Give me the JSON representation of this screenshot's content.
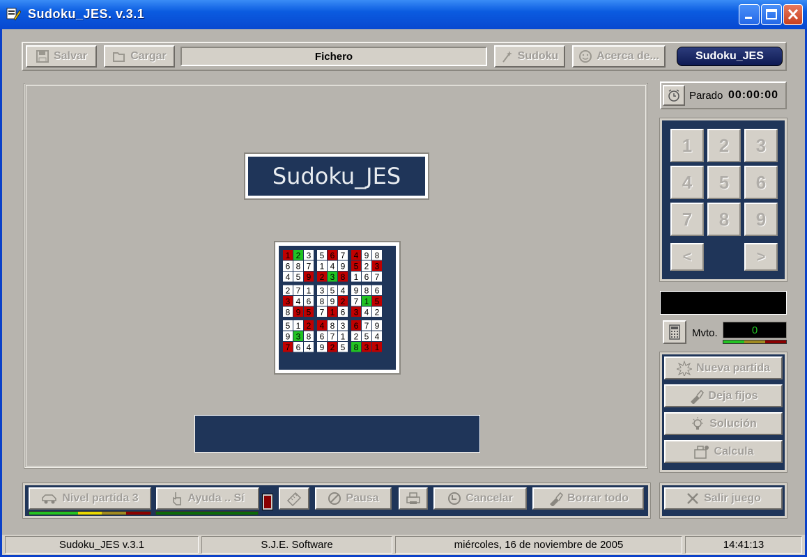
{
  "window": {
    "title": "Sudoku_JES. v.3.1"
  },
  "toolbar": {
    "salvar": "Salvar",
    "cargar": "Cargar",
    "fichero": "Fichero",
    "sudoku": "Sudoku",
    "acerca": "Acerca de...",
    "brand": "Sudoku_JES"
  },
  "main": {
    "logo_text": "Sudoku_JES",
    "thumbnail_grid": [
      [
        1,
        2,
        3,
        5,
        6,
        7,
        4,
        9,
        8
      ],
      [
        6,
        8,
        7,
        1,
        4,
        9,
        5,
        2,
        3
      ],
      [
        4,
        5,
        9,
        2,
        3,
        8,
        1,
        6,
        7
      ],
      [
        2,
        7,
        1,
        3,
        5,
        4,
        9,
        8,
        6
      ],
      [
        3,
        4,
        6,
        8,
        9,
        2,
        7,
        1,
        5
      ],
      [
        8,
        9,
        5,
        7,
        1,
        6,
        3,
        4,
        2
      ],
      [
        5,
        1,
        2,
        4,
        8,
        3,
        6,
        7,
        9
      ],
      [
        9,
        3,
        8,
        6,
        7,
        1,
        2,
        5,
        4
      ],
      [
        7,
        6,
        4,
        9,
        2,
        5,
        8,
        3,
        1
      ]
    ],
    "thumbnail_colors": [
      [
        "r",
        "g",
        "w",
        "w",
        "r",
        "w",
        "r",
        "w",
        "w"
      ],
      [
        "w",
        "w",
        "w",
        "w",
        "w",
        "w",
        "r",
        "w",
        "r"
      ],
      [
        "w",
        "w",
        "r",
        "r",
        "g",
        "r",
        "w",
        "w",
        "w"
      ],
      [
        "w",
        "w",
        "w",
        "w",
        "w",
        "w",
        "w",
        "w",
        "w"
      ],
      [
        "r",
        "w",
        "w",
        "w",
        "w",
        "r",
        "w",
        "g",
        "r"
      ],
      [
        "w",
        "r",
        "r",
        "w",
        "r",
        "w",
        "r",
        "w",
        "w"
      ],
      [
        "w",
        "w",
        "r",
        "r",
        "w",
        "w",
        "r",
        "w",
        "w"
      ],
      [
        "w",
        "g",
        "w",
        "w",
        "w",
        "w",
        "w",
        "w",
        "w"
      ],
      [
        "r",
        "w",
        "w",
        "w",
        "r",
        "w",
        "g",
        "r",
        "r"
      ]
    ]
  },
  "timer": {
    "state": "Parado",
    "time": "00:00:00"
  },
  "numpad": {
    "keys": [
      "1",
      "2",
      "3",
      "4",
      "5",
      "6",
      "7",
      "8",
      "9"
    ],
    "prev": "<",
    "next": ">"
  },
  "moves": {
    "label": "Mvto.",
    "value": "0"
  },
  "actions": {
    "nueva": "Nueva partida",
    "deja": "Deja fijos",
    "solucion": "Solución",
    "calcula": "Calcula"
  },
  "bottom": {
    "nivel": "Nivel partida 3",
    "ayuda": "Ayuda .. Sí",
    "pausa": "Pausa",
    "cancelar": "Cancelar",
    "borrar": "Borrar todo",
    "salir": "Salir juego"
  },
  "status": {
    "app": "Sudoku_JES  v.3.1",
    "company": "S.J.E. Software",
    "date": "miércoles, 16 de noviembre de 2005",
    "time": "14:41:13"
  },
  "colors": {
    "navy": "#1f3559",
    "red": "#c00000",
    "green": "#22c322"
  }
}
